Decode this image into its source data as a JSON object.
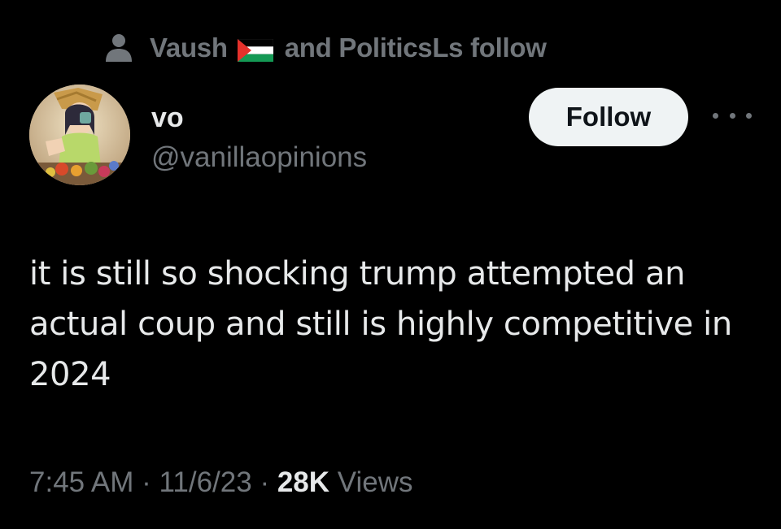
{
  "social_context": {
    "first_name": "Vaush",
    "flag_icon": "palestine-flag-icon",
    "rest": "and PoliticsLs follow",
    "icon": "person-icon"
  },
  "user": {
    "display_name": "vo",
    "handle": "@vanillaopinions",
    "avatar_icon": "avatar-image"
  },
  "actions": {
    "follow_label": "Follow",
    "more_icon": "more-options-icon"
  },
  "tweet": {
    "text": "it is still so shocking trump attempted an actual coup and still is highly competitive in 2024"
  },
  "meta": {
    "time": "7:45 AM",
    "sep1": " · ",
    "date": "11/6/23",
    "sep2": " · ",
    "views_count": "28K",
    "views_label": " Views"
  },
  "colors": {
    "background": "#000000",
    "primary_text": "#e7e9ea",
    "secondary_text": "#71767b",
    "follow_bg": "#eff3f4",
    "follow_text": "#0f1419"
  }
}
